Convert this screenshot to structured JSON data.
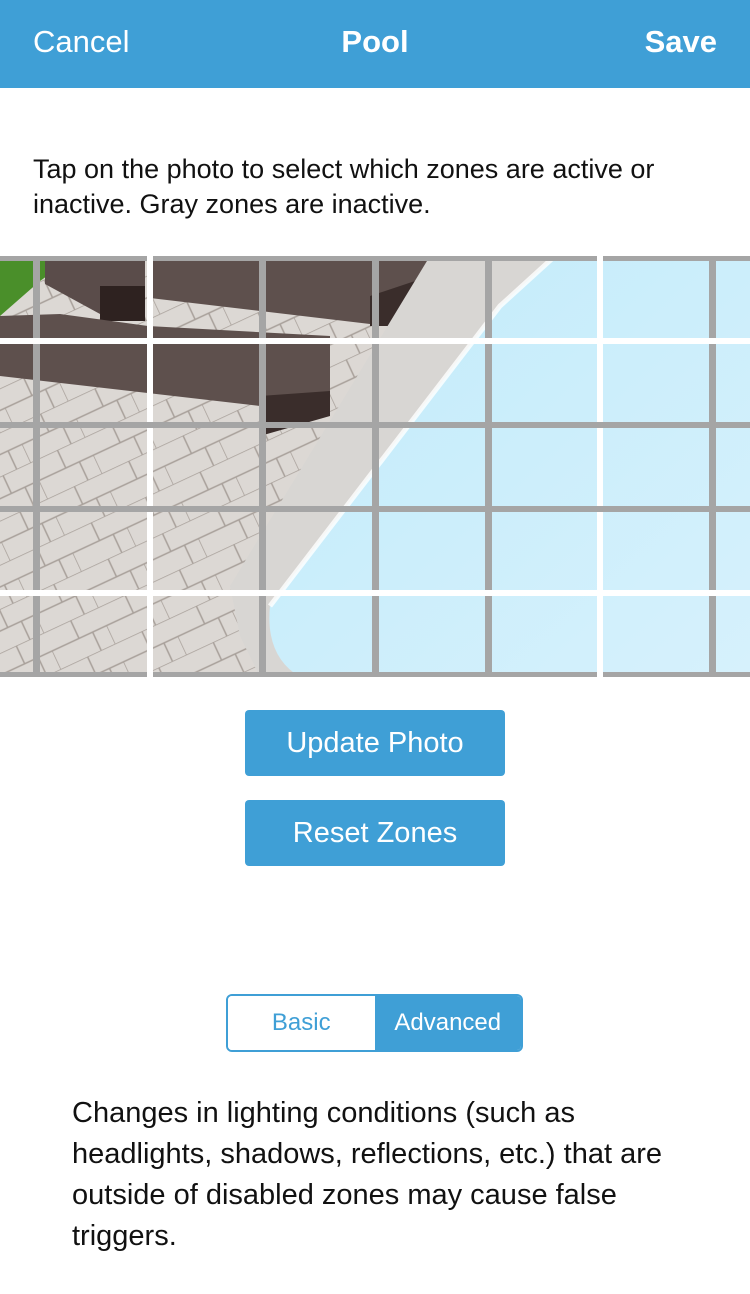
{
  "navbar": {
    "cancel_label": "Cancel",
    "title": "Pool",
    "save_label": "Save",
    "background_color": "#3f9fd6"
  },
  "instructions": "Tap on the photo to select which zones are active or inactive. Gray zones are inactive.",
  "zone_grid": {
    "columns": 7,
    "rows": 5,
    "photo_subject": "pool deck with dark benches, paving stones and pool water"
  },
  "buttons": {
    "update_photo": "Update Photo",
    "reset_zones": "Reset Zones"
  },
  "mode_toggle": {
    "options": [
      "Basic",
      "Advanced"
    ],
    "selected": "Advanced"
  },
  "note": "Changes in lighting conditions (such as headlights, shadows, reflections, etc.) that are outside of disabled zones may cause false triggers."
}
